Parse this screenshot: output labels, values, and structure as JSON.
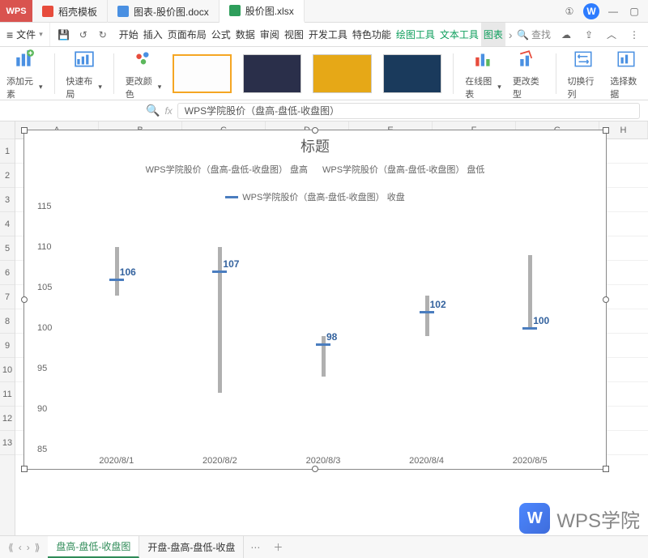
{
  "app_name": "WPS",
  "file_tabs": [
    "稻壳模板",
    "图表-股价图.docx",
    "股价图.xlsx"
  ],
  "file_menu_label": "文件",
  "ribbon_tabs": [
    "开始",
    "插入",
    "页面布局",
    "公式",
    "数据",
    "审阅",
    "视图",
    "开发工具",
    "特色功能",
    "绘图工具",
    "文本工具",
    "图表工具"
  ],
  "search_placeholder": "查找",
  "ribbon_groups": {
    "add_element": "添加元素",
    "quick_layout": "快速布局",
    "change_color": "更改颜色",
    "online_chart": "在线图表",
    "change_type": "更改类型",
    "switch_rowcol": "切换行列",
    "select_data": "选择数据"
  },
  "formula_bar_value": "WPS学院股价（盘高-盘低-收盘图）",
  "columns": [
    "A",
    "B",
    "C",
    "D",
    "E",
    "F",
    "G",
    "H"
  ],
  "rows": [
    "1",
    "2",
    "3",
    "4",
    "5",
    "6",
    "7",
    "8",
    "9",
    "10",
    "11",
    "12",
    "13"
  ],
  "sheet_tabs": [
    "盘高-盘低-收盘图",
    "开盘-盘高-盘低-收盘"
  ],
  "watermark_text": "WPS学院",
  "chart": {
    "title": "标题",
    "legend": [
      "WPS学院股价（盘高-盘低-收盘图）  盘高",
      "WPS学院股价（盘高-盘低-收盘图）  盘低",
      "WPS学院股价（盘高-盘低-收盘图）  收盘"
    ]
  },
  "chart_data": {
    "type": "stock-hlc",
    "title": "标题",
    "x_categories": [
      "2020/8/1",
      "2020/8/2",
      "2020/8/3",
      "2020/8/4",
      "2020/8/5"
    ],
    "series": [
      {
        "name": "盘高",
        "values": [
          110,
          110,
          99,
          104,
          109
        ]
      },
      {
        "name": "盘低",
        "values": [
          104,
          92,
          94,
          99,
          100
        ]
      },
      {
        "name": "收盘",
        "values": [
          106,
          107,
          98,
          102,
          100
        ]
      }
    ],
    "data_labels_series": "收盘",
    "ylim": [
      85,
      115
    ],
    "y_ticks": [
      85,
      90,
      95,
      100,
      105,
      110,
      115
    ],
    "xlabel": "",
    "ylabel": ""
  }
}
